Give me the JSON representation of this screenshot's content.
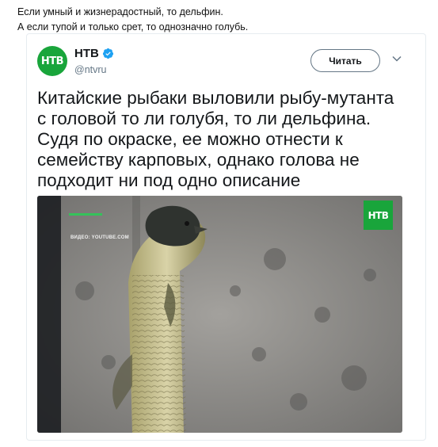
{
  "caption": {
    "line1": "Если умный и жизнерадостный, то дельфин.",
    "line2": "А если тупой и только срет, то однозначно голубь."
  },
  "tweet": {
    "account_name": "НТВ",
    "handle": "@ntvru",
    "avatar_text": "НТВ",
    "follow_label": "Читать",
    "text_lines": [
      "Китайские рыбаки выловили рыбу-мутанта",
      "с головой то ли голубя, то ли дельфина.",
      "Судя по окраске, ее можно отнести к",
      "семейству карповых, однако голова не",
      "подходит ни под одно описание"
    ],
    "media": {
      "source_label": "ВИДЕО: YOUTUBE.COM",
      "badge_text": "НТВ"
    }
  },
  "colors": {
    "ntv_green": "#19a53b",
    "verified_blue": "#1da1f2",
    "muted_text": "#657786"
  }
}
